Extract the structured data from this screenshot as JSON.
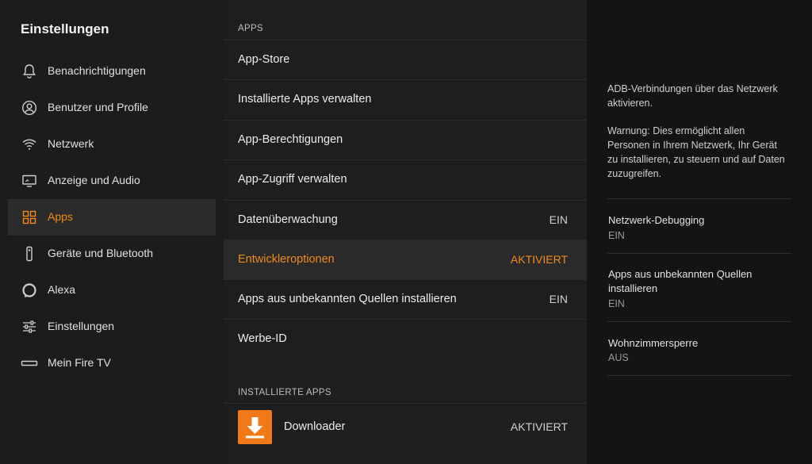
{
  "sidebar": {
    "title": "Einstellungen",
    "items": [
      {
        "label": "Benachrichtigungen",
        "icon": "bell-icon"
      },
      {
        "label": "Benutzer und Profile",
        "icon": "user-icon"
      },
      {
        "label": "Netzwerk",
        "icon": "wifi-icon"
      },
      {
        "label": "Anzeige und Audio",
        "icon": "display-audio-icon"
      },
      {
        "label": "Apps",
        "icon": "apps-grid-icon",
        "active": true
      },
      {
        "label": "Geräte und Bluetooth",
        "icon": "remote-icon"
      },
      {
        "label": "Alexa",
        "icon": "alexa-icon"
      },
      {
        "label": "Einstellungen",
        "icon": "sliders-icon"
      },
      {
        "label": "Mein Fire TV",
        "icon": "firetv-stick-icon"
      }
    ]
  },
  "middle": {
    "section_apps": "APPS",
    "rows": [
      {
        "label": "App-Store",
        "value": ""
      },
      {
        "label": "Installierte Apps verwalten",
        "value": ""
      },
      {
        "label": "App-Berechtigungen",
        "value": ""
      },
      {
        "label": "App-Zugriff verwalten",
        "value": ""
      },
      {
        "label": "Datenüberwachung",
        "value": "EIN"
      },
      {
        "label": "Entwickleroptionen",
        "value": "AKTIVIERT"
      },
      {
        "label": "Apps aus unbekannten Quellen installieren",
        "value": "EIN"
      },
      {
        "label": "Werbe-ID",
        "value": ""
      }
    ],
    "section_installed": "INSTALLIERTE APPS",
    "installed_app": {
      "label": "Downloader",
      "value": "AKTIVIERT",
      "icon": "download-arrow-icon"
    }
  },
  "right": {
    "desc1": "ADB-Verbindungen über das Netzwerk aktivieren.",
    "desc2": "Warnung: Dies ermöglicht allen Personen in Ihrem Netzwerk, Ihr Gerät zu installieren, zu steuern und auf Daten zuzugreifen.",
    "items": [
      {
        "title": "Netzwerk-Debugging",
        "value": "EIN"
      },
      {
        "title": "Apps aus unbekannten Quellen installieren",
        "value": "EIN"
      },
      {
        "title": "Wohnzimmersperre",
        "value": "AUS"
      }
    ]
  },
  "colors": {
    "accent": "#f08a1c",
    "sidebar_bg": "#1c1c1c",
    "middle_bg": "#1e1e1e",
    "right_bg": "#141414"
  }
}
